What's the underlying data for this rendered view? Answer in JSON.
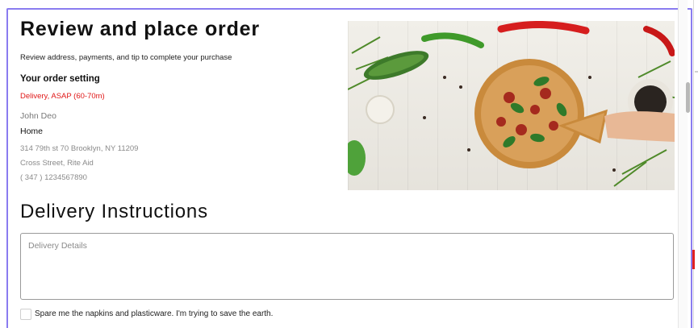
{
  "page": {
    "title": "Review and place order",
    "subtitle": "Review address, payments, and tip to complete your purchase"
  },
  "order_setting": {
    "heading": "Your order setting",
    "delivery_type": "Delivery, ASAP (60-70m)",
    "name": "John Deo",
    "address_label": "Home",
    "address_line1": "314 79th st 70 Brooklyn, NY 11209",
    "address_line2": "Cross Street, Rite Aid",
    "phone": "( 347 ) 1234567890"
  },
  "hero_image": {
    "icon": "pizza-photo"
  },
  "delivery_instructions": {
    "heading": "Delivery Instructions",
    "placeholder": "Delivery Details",
    "value": "",
    "napkins_checkbox_label": "Spare me the napkins and plasticware. I'm trying to save the earth.",
    "napkins_checked": false
  },
  "colors": {
    "accent_border": "#8a7cf0",
    "delivery_red": "#e01818"
  }
}
